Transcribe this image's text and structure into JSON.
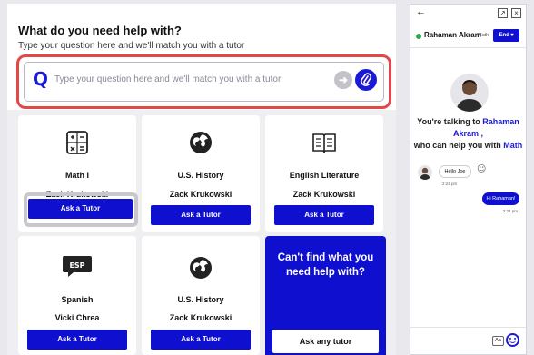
{
  "header": {
    "title": "What do you need help with?",
    "subtitle": "Type your question here and we'll match you with a tutor"
  },
  "search": {
    "q_glyph": "Q",
    "placeholder": "Type your question here and we'll match you with a tutor",
    "submit_icon": "arrow-right-icon",
    "attach_icon": "paperclip-icon"
  },
  "cards": [
    {
      "icon": "calculator-icon",
      "subject": "Math I",
      "tutor": "Zack Krukowski",
      "button": "Ask a Tutor"
    },
    {
      "icon": "globe-icon",
      "subject": "U.S. History",
      "tutor": "Zack Krukowski",
      "button": "Ask a Tutor"
    },
    {
      "icon": "book-icon",
      "subject": "English Literature",
      "tutor": "Zack Krukowski",
      "button": "Ask a Tutor"
    },
    {
      "icon": "esp-icon",
      "icon_text": "ESP",
      "subject": "Spanish",
      "tutor": "Vicki Chrea",
      "button": "Ask a Tutor"
    },
    {
      "icon": "globe-icon",
      "subject": "U.S. History",
      "tutor": "Zack Krukowski",
      "button": "Ask a Tutor"
    }
  ],
  "cta": {
    "text": "Can't find what you need help with?",
    "button": "Ask any tutor"
  },
  "chat": {
    "back_icon": "back-arrow-icon",
    "tutor_name": "Rahaman Akram",
    "tutor_tag": "Math",
    "end_label": "End ▾",
    "talking_prefix": "You're talking to ",
    "talking_name": "Rahaman Akram ,",
    "talking_middle": "who can help you with ",
    "talking_subject": "Math",
    "messages": [
      {
        "from": "tutor",
        "text": "Hello Joe",
        "time": "2:24 pm"
      },
      {
        "from": "user",
        "text": "Hi Rahaman!",
        "time": "2:24 pm"
      }
    ],
    "format_label": "Aa"
  },
  "colors": {
    "accent": "#0f0fd0",
    "highlight": "#e34848",
    "online": "#2ea84f"
  }
}
